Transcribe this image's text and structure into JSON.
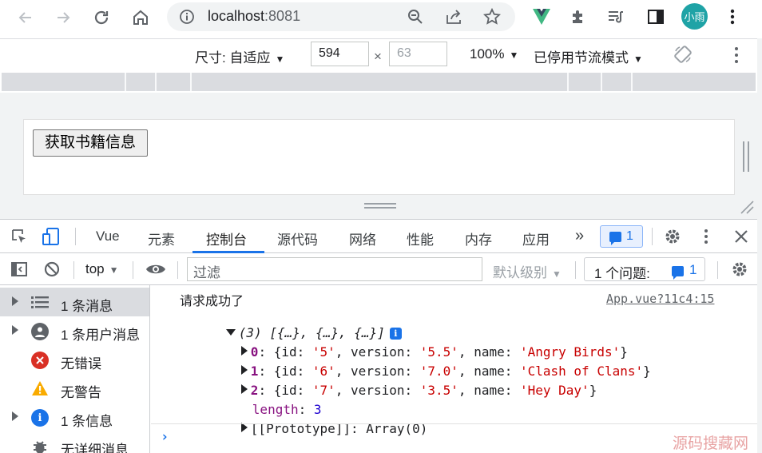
{
  "browser": {
    "url_host": "localhost",
    "url_port": ":8081",
    "avatar_text": "小雨",
    "icons": [
      "back-icon",
      "forward-icon",
      "reload-icon",
      "home-icon",
      "info-icon",
      "zoom-icon",
      "share-icon",
      "star-icon",
      "vue-devtools-icon",
      "extensions-icon",
      "reading-list-icon",
      "side-panel-icon",
      "menu-icon"
    ]
  },
  "device_toolbar": {
    "size_label": "尺寸: 自适应",
    "width_value": "594",
    "times": "×",
    "height_placeholder": "63",
    "zoom": "100%",
    "throttle": "已停用节流模式"
  },
  "page": {
    "button_label": "获取书籍信息"
  },
  "devtools": {
    "tabs": [
      "Vue",
      "元素",
      "控制台",
      "源代码",
      "网络",
      "性能",
      "内存",
      "应用"
    ],
    "active_tab": "控制台",
    "more_tabs": "»",
    "issues_count": "1",
    "console_bar": {
      "context": "top",
      "filter_placeholder": "过滤",
      "level": "默认级别",
      "issues_label": "1 个问题:",
      "issues_count": "1"
    },
    "sidebar": [
      {
        "label": "1 条消息",
        "icon": "list-icon",
        "expandable": true,
        "selected": true
      },
      {
        "label": "1 条用户消息",
        "icon": "user-icon",
        "expandable": true,
        "selected": false
      },
      {
        "label": "无错误",
        "icon": "error-icon",
        "expandable": false,
        "selected": false
      },
      {
        "label": "无警告",
        "icon": "warning-icon",
        "expandable": false,
        "selected": false
      },
      {
        "label": "1 条信息",
        "icon": "info-icon",
        "expandable": true,
        "selected": false
      },
      {
        "label": "无详细消息",
        "icon": "bug-icon",
        "expandable": false,
        "selected": false
      }
    ],
    "console": {
      "message": "请求成功了",
      "source": "App.vue?11c4:15",
      "array_summary": "(3) [{…}, {…}, {…}]",
      "items": [
        {
          "index": "0",
          "id": "'5'",
          "version": "'5.5'",
          "name": "'Angry Birds'"
        },
        {
          "index": "1",
          "id": "'6'",
          "version": "'7.0'",
          "name": "'Clash of Clans'"
        },
        {
          "index": "2",
          "id": "'7'",
          "version": "'3.5'",
          "name": "'Hey Day'"
        }
      ],
      "length_key": "length",
      "length_value": "3",
      "prototype": "[[Prototype]]: Array(0)"
    }
  },
  "watermark": "源码搜藏网"
}
